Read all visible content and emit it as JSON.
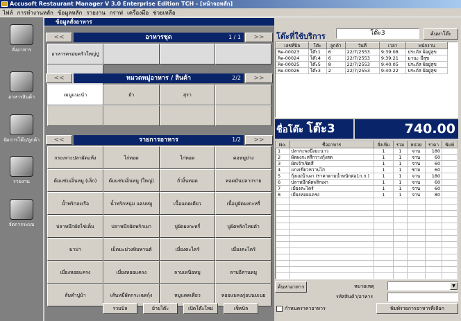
{
  "window": {
    "title": "Accusoft Restaurant Manager V 3.0 Enterprise Edition TCH - [หน้าจอหลัก]"
  },
  "menu": [
    "ไฟล์",
    "การทำงานหลัก",
    "ข้อมูลหลัก",
    "รายงาน",
    "กราฟ",
    "เครื่องมือ",
    "ช่วยเหลือ"
  ],
  "sidebar": [
    {
      "label": "สั่งอาหาร",
      "icon": "notebook-icon"
    },
    {
      "label": "อาหารสินค้า",
      "icon": "food-plate-icon"
    },
    {
      "label": "จัดการโต๊ะ/ลูกค้า",
      "icon": "money-icon"
    },
    {
      "label": "รายงาน",
      "icon": "printer-icon"
    },
    {
      "label": "จัดการระบบ",
      "icon": "gears-icon"
    }
  ],
  "child_title": "ข้อมูลสั่งอาหาร",
  "set_menu": {
    "title": "อาหารชุด",
    "count": "1 / 1",
    "prev": "<<",
    "next": ">>",
    "items": [
      "อาหารครอบครัวใหญ่ปู",
      "",
      "",
      "",
      ""
    ]
  },
  "category": {
    "title": "หมวดหมู่อาหาร / สินค้า",
    "count": "2/2",
    "prev": "<<",
    "next": ">>",
    "items": [
      "เมนูแนะนำ",
      "ยำ",
      "สุรา",
      "",
      "",
      "",
      "",
      ""
    ]
  },
  "food": {
    "title": "รายการอาหาร",
    "count": "1/2",
    "prev": "<<",
    "next": ">>",
    "items": [
      "กระเพาะปลาผัดแห้ง",
      "ไก่ทอด",
      "ไก่ทอด",
      "คอหมูย่าง",
      "ต้มแซ่บเอ็นหมู (เล็ก)",
      "ต้มแซ่บเอ็นหมู (ใหญ่)",
      "ถั่วงิ้นทอด",
      "ทอดมันปลากราย",
      "น้ำพริกลงเรือ",
      "น้ำพริกหนุ่ม แคบหมู",
      "เนื้อแดดเดียว",
      "เนื้อปูผัดผงกะหรี่",
      "ปลาหมึกผัดไข่เค็ม",
      "ปลาหมึกผัดพริกเผา",
      "ปูผัดผงกะหรี่",
      "ปูผัดพริกไทยดำ",
      "มาม่า",
      "เม็ดมะม่วงหิมพานต์",
      "เมี่ยงคะไคร้",
      "เมี่ยงคะไคร้",
      "เมี่ยงหอยแครง",
      "เมี่ยงหอยแครง",
      "ลาบเหนือหมู",
      "ลาบอีสานหมู",
      "ส้มตำปูม้า",
      "เส้นหมี่ผัดกระเฉดกุ้ง",
      "หมูแดดเดียว",
      "หอยแมลงภู่อบนมเนย"
    ]
  },
  "bottom_buttons": [
    "รวมบิล",
    "ย้ายโต๊ะ",
    "เปิดโต๊ะใหม่",
    "เช็คบิล"
  ],
  "service": {
    "title": "โต๊ะที่ใช้บริการ",
    "table_value": "โต๊ะ3",
    "search_btn": "ค้นหาโต๊ะ",
    "columns": [
      "เลขที่บิล",
      "โต๊ะ",
      "ลูกค้า",
      "วันที่",
      "เวลา",
      "พนักงาน"
    ],
    "rows": [
      [
        "Re-00023",
        "โต๊ะ1",
        "6",
        "22/7/2553",
        "9:39:08",
        "ประภัส ผ้อยู่สุข"
      ],
      [
        "Re-00024",
        "โต๊ะ4",
        "6",
        "22/7/2553",
        "9:39:21",
        "มานะ มีสุข"
      ],
      [
        "Re-00025",
        "โต๊ะ5",
        "8",
        "22/7/2553",
        "9:40:05",
        "ประภัส ผ้อยู่สุข"
      ],
      [
        "Re-00026",
        "โต๊ะ3",
        "2",
        "22/7/2553",
        "9:40:22",
        "ประภัส ผ้อยู่สุข"
      ]
    ]
  },
  "bill": {
    "label": "ชื่อโต๊ะ",
    "table_name": "โต๊ะ3",
    "total": "740.00",
    "columns": [
      "No.",
      "ชื่ออาหาร",
      "สั่งเพิ่ม",
      "รวม",
      "หน่วย",
      "ราคา",
      "พิมพ์"
    ],
    "rows": [
      [
        "1",
        "ปลากะพงนึ่งมะนาว",
        "1",
        "1",
        "จาน",
        "180",
        ""
      ],
      [
        "2",
        "ผัดผงกะหรี่กวางกุ้งสด",
        "1",
        "1",
        "จาน",
        "60",
        ""
      ],
      [
        "3",
        "ผัดเจ้าเช็ดสี",
        "1",
        "1",
        "จาน",
        "60",
        ""
      ],
      [
        "4",
        "แกงเขียวหวานไก่",
        "1",
        "1",
        "ชาม",
        "60",
        ""
      ],
      [
        "5",
        "กุ้งแม่น้ำเผา (ราคาตามน้ำหนักต่อ1ก.ก.)",
        "1",
        "1",
        "จาน",
        "180",
        ""
      ],
      [
        "6",
        "ปลาหมึกผัดพริกเผา",
        "1",
        "1",
        "จาน",
        "60",
        ""
      ],
      [
        "7",
        "เมี่ยงคะไคร้",
        "1",
        "1",
        "จาน",
        "60",
        ""
      ],
      [
        "8",
        "เมี่ยงหอยแครง",
        "1",
        "1",
        "จาน",
        "80",
        ""
      ]
    ]
  },
  "form": {
    "search_food_btn": "ค้นหาอาหาร",
    "note_label": "หมายเหตุ",
    "code_label": "รหัสสินค้า/อาหาร",
    "checkbox_label": "กำหนดราคาอาหาร",
    "print_btn": "พิมพ์รายการอาหารที่เลือก"
  }
}
